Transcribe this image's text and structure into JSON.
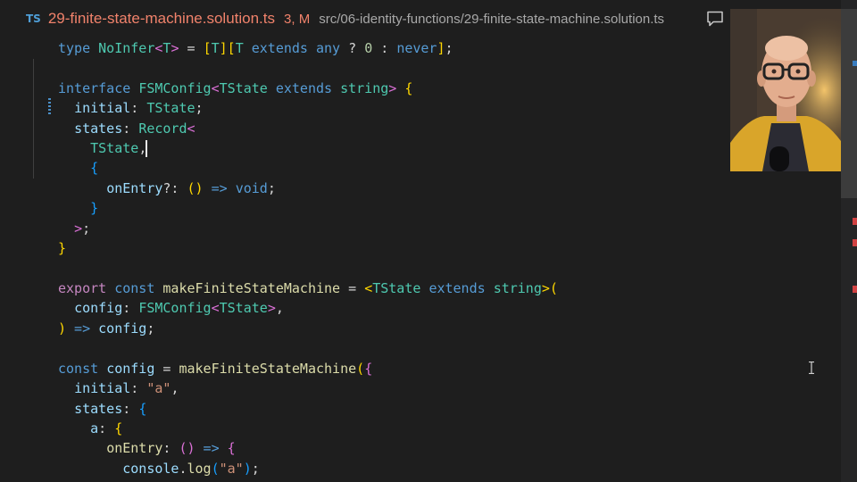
{
  "tab": {
    "lang_badge": "TS",
    "file_name": "29-finite-state-machine.solution.ts",
    "status": "3, M",
    "path": "src/06-identity-functions/29-finite-state-machine.solution.ts"
  },
  "colors": {
    "background": "#1e1e1e",
    "modified_file": "#f0826b",
    "keyword": "#569cd6",
    "type": "#4ec9b0",
    "string": "#ce9178",
    "function": "#dcdcaa"
  },
  "code": {
    "l1": {
      "a": "type",
      "b": "NoInfer",
      "c": "<",
      "d": "T",
      "e": ">",
      "f": " = ",
      "g": "[",
      "h": "T",
      "i": "]",
      "j": "[",
      "k": "T",
      "l": "extends",
      "m": "any",
      "n": "?",
      "o": "0",
      "p": ":",
      "q": "never",
      "r": "]",
      "s": ";"
    },
    "l2": {
      "a": "interface",
      "b": "FSMConfig",
      "c": "<",
      "d": "TState",
      "e": "extends",
      "f": "string",
      "g": ">",
      "h": "{"
    },
    "l3": {
      "a": "initial",
      "b": ": ",
      "c": "TState",
      "d": ";"
    },
    "l4": {
      "a": "states",
      "b": ": ",
      "c": "Record",
      "d": "<"
    },
    "l5": {
      "a": "TState",
      "b": ","
    },
    "l6": {
      "a": "{"
    },
    "l7": {
      "a": "onEntry",
      "b": "?: ",
      "c": "()",
      "d": " => ",
      "e": "void",
      "f": ";"
    },
    "l8": {
      "a": "}"
    },
    "l9": {
      "a": ">",
      "b": ";"
    },
    "l10": {
      "a": "}"
    },
    "l11": {
      "a": "export",
      "b": "const",
      "c": "makeFiniteStateMachine",
      "d": " = ",
      "e": "<",
      "f": "TState",
      "g": "extends",
      "h": "string",
      "i": ">",
      "j": "("
    },
    "l12": {
      "a": "config",
      "b": ": ",
      "c": "FSMConfig",
      "d": "<",
      "e": "TState",
      "f": ">",
      "g": ","
    },
    "l13": {
      "a": ")",
      "b": " => ",
      "c": "config",
      "d": ";"
    },
    "l14": {
      "a": "const",
      "b": "config",
      "c": " = ",
      "d": "makeFiniteStateMachine",
      "e": "(",
      "f": "{"
    },
    "l15": {
      "a": "initial",
      "b": ": ",
      "c": "\"a\"",
      "d": ","
    },
    "l16": {
      "a": "states",
      "b": ": ",
      "c": "{"
    },
    "l17": {
      "a": "a",
      "b": ": ",
      "c": "{"
    },
    "l18": {
      "a": "onEntry",
      "b": ": ",
      "c": "()",
      "d": " => ",
      "e": "{"
    },
    "l19": {
      "a": "console",
      "b": ".",
      "c": "log",
      "d": "(",
      "e": "\"a\"",
      "f": ")",
      "g": ";"
    }
  }
}
